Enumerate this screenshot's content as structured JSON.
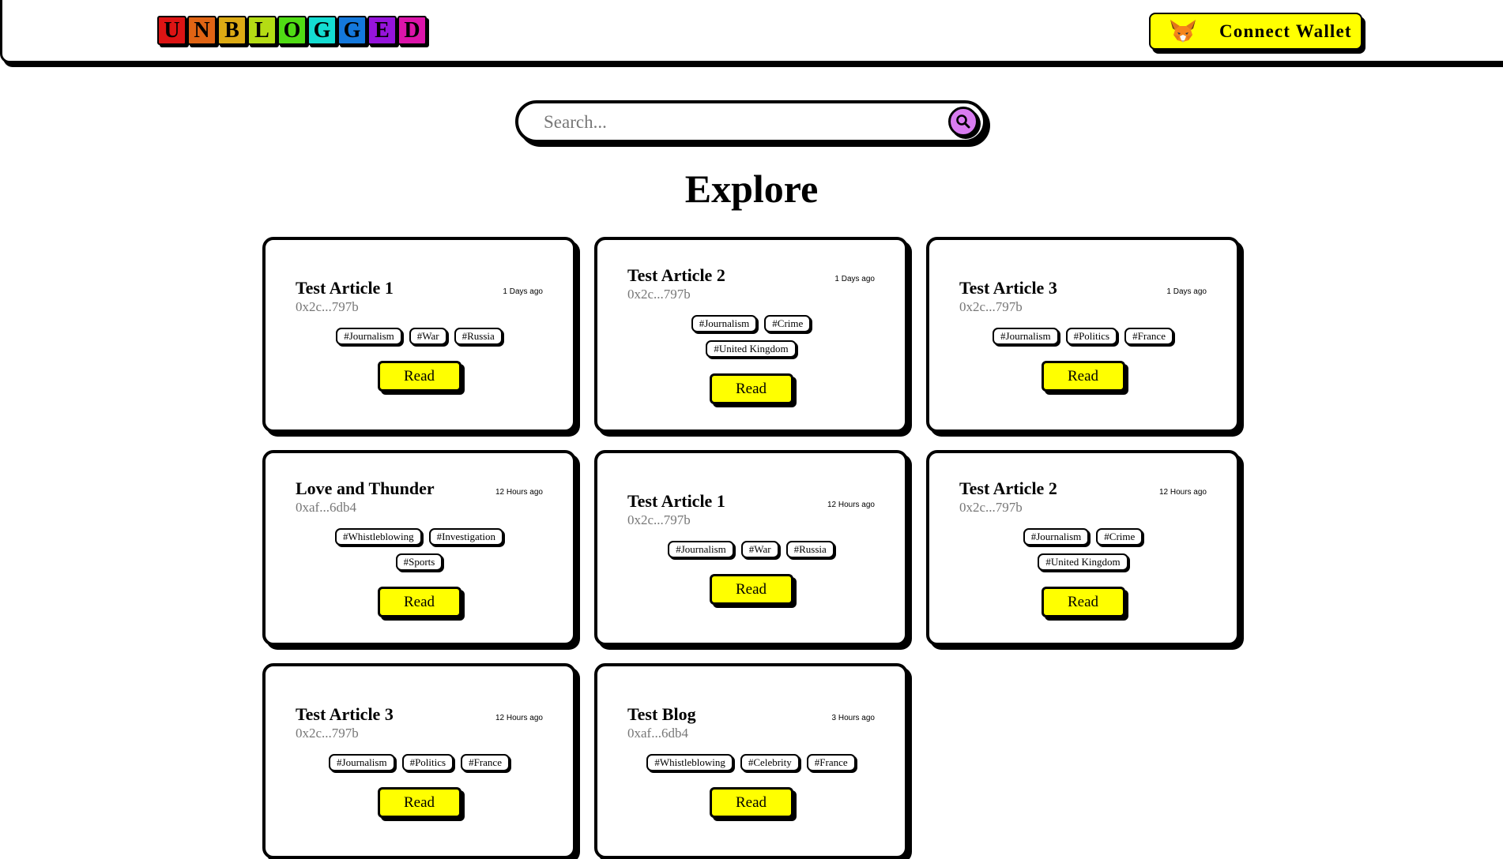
{
  "header": {
    "logo_letters": [
      {
        "char": "U",
        "color": "#dc1414"
      },
      {
        "char": "N",
        "color": "#e06414"
      },
      {
        "char": "B",
        "color": "#dcaa14"
      },
      {
        "char": "L",
        "color": "#b4dc14"
      },
      {
        "char": "O",
        "color": "#50dc14"
      },
      {
        "char": "G",
        "color": "#14dcd2"
      },
      {
        "char": "G",
        "color": "#1478dc"
      },
      {
        "char": "E",
        "color": "#9614dc"
      },
      {
        "char": "D",
        "color": "#dc14aa"
      }
    ],
    "wallet_button": {
      "label": "Connect Wallet",
      "icon": "metamask-fox-icon",
      "color": "#ffff00"
    }
  },
  "search": {
    "placeholder": "Search...",
    "value": "",
    "button_color": "#d97cf0",
    "icon": "search-icon"
  },
  "page_title": "Explore",
  "articles": [
    {
      "title": "Test Article 1",
      "time": "1 Days ago",
      "author": "0x2c...797b",
      "tags": [
        "#Journalism",
        "#War",
        "#Russia"
      ],
      "button": "Read"
    },
    {
      "title": "Test Article 2",
      "time": "1 Days ago",
      "author": "0x2c...797b",
      "tags": [
        "#Journalism",
        "#Crime",
        "#United Kingdom"
      ],
      "button": "Read"
    },
    {
      "title": "Test Article 3",
      "time": "1 Days ago",
      "author": "0x2c...797b",
      "tags": [
        "#Journalism",
        "#Politics",
        "#France"
      ],
      "button": "Read"
    },
    {
      "title": "Love and Thunder",
      "time": "12 Hours ago",
      "author": "0xaf...6db4",
      "tags": [
        "#Whistleblowing",
        "#Investigation",
        "#Sports"
      ],
      "button": "Read"
    },
    {
      "title": "Test Article 1",
      "time": "12 Hours ago",
      "author": "0x2c...797b",
      "tags": [
        "#Journalism",
        "#War",
        "#Russia"
      ],
      "button": "Read"
    },
    {
      "title": "Test Article 2",
      "time": "12 Hours ago",
      "author": "0x2c...797b",
      "tags": [
        "#Journalism",
        "#Crime",
        "#United Kingdom"
      ],
      "button": "Read"
    },
    {
      "title": "Test Article 3",
      "time": "12 Hours ago",
      "author": "0x2c...797b",
      "tags": [
        "#Journalism",
        "#Politics",
        "#France"
      ],
      "button": "Read"
    },
    {
      "title": "Test Blog",
      "time": "3 Hours ago",
      "author": "0xaf...6db4",
      "tags": [
        "#Whistleblowing",
        "#Celebrity",
        "#France"
      ],
      "button": "Read"
    }
  ],
  "colors": {
    "accent_yellow": "#ffff00",
    "border": "#000000",
    "author_gray": "#777777"
  }
}
